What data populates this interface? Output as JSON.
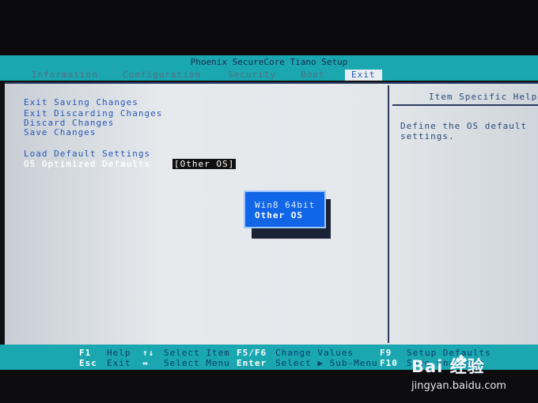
{
  "title": "Phoenix SecureCore Tiano Setup",
  "menu": [
    {
      "label": "Information",
      "active": false
    },
    {
      "label": "Configuration",
      "active": false
    },
    {
      "label": "Security",
      "active": false
    },
    {
      "label": "Boot",
      "active": false
    },
    {
      "label": "Exit",
      "active": true
    }
  ],
  "exit_items": [
    "Exit Saving Changes",
    "Exit Discarding Changes",
    "Discard Changes",
    "Save Changes",
    "Load Default Settings",
    "OS Optimized Defaults"
  ],
  "os_optimized_value": "[Other OS]",
  "help": {
    "title": "Item Specific Help",
    "text": "Define the OS default settings."
  },
  "popup": {
    "options": [
      "Win8 64bit",
      "Other OS"
    ],
    "selected": "Other OS"
  },
  "status": {
    "f1_key": "F1",
    "f1_desc": "Help",
    "esc_key": "Esc",
    "esc_desc": "Exit",
    "updown_key": "↑↓",
    "updown_desc": "Select Item",
    "leftright_key": "↔",
    "leftright_desc": "Select Menu",
    "f5f6_key": "F5/F6",
    "f5f6_desc": "Change Values",
    "enter_key": "Enter",
    "enter_desc": "Select ▶ Sub-Menu",
    "f9_key": "F9",
    "f9_desc": "Setup Defaults",
    "f10_key": "F10",
    "f10_desc": "Save and Exit"
  },
  "watermark": {
    "brand": "Bai 经验",
    "url": "jingyan.baidu.com"
  },
  "colors": {
    "title_bar": "#1aa7b0",
    "screen": "#e3e7ea",
    "popup": "#1166e8",
    "link_text": "#2a56b8"
  }
}
